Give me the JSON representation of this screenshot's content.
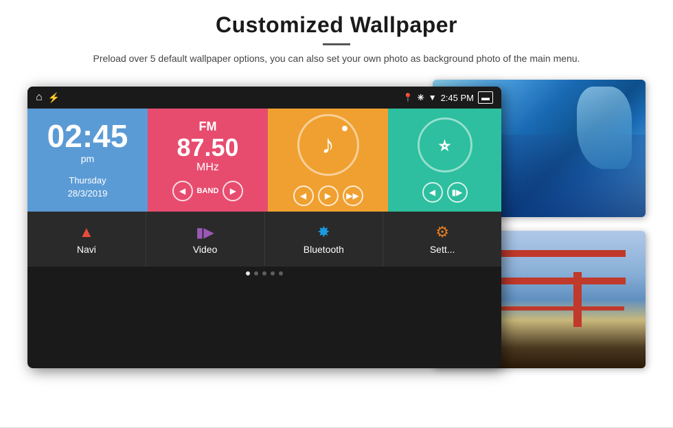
{
  "page": {
    "title": "Customized Wallpaper",
    "description": "Preload over 5 default wallpaper options, you can also set your own photo as background photo of the main menu."
  },
  "status_bar": {
    "time": "2:45 PM",
    "icons": [
      "location-pin",
      "bluetooth",
      "wifi",
      "battery"
    ]
  },
  "clock_tile": {
    "time": "02:45",
    "ampm": "pm",
    "day": "Thursday",
    "date": "28/3/2019"
  },
  "radio_tile": {
    "label": "FM",
    "frequency": "87.50",
    "unit": "MHz"
  },
  "nav_items": [
    {
      "id": "navi",
      "label": "Navi",
      "icon": "▲"
    },
    {
      "id": "video",
      "label": "Video",
      "icon": "▶"
    },
    {
      "id": "bluetooth",
      "label": "Bluetooth",
      "icon": "Ƀ"
    },
    {
      "id": "settings",
      "label": "Sett...",
      "icon": "⚙"
    }
  ],
  "dots": [
    {
      "active": true
    },
    {
      "active": false
    },
    {
      "active": false
    },
    {
      "active": false
    },
    {
      "active": false
    }
  ],
  "colors": {
    "clock_bg": "#5b9bd5",
    "radio_bg": "#e74c6f",
    "music_bg": "#f0a030",
    "bt_bg": "#2dbf9f",
    "nav_bg": "#2a2a2a"
  }
}
